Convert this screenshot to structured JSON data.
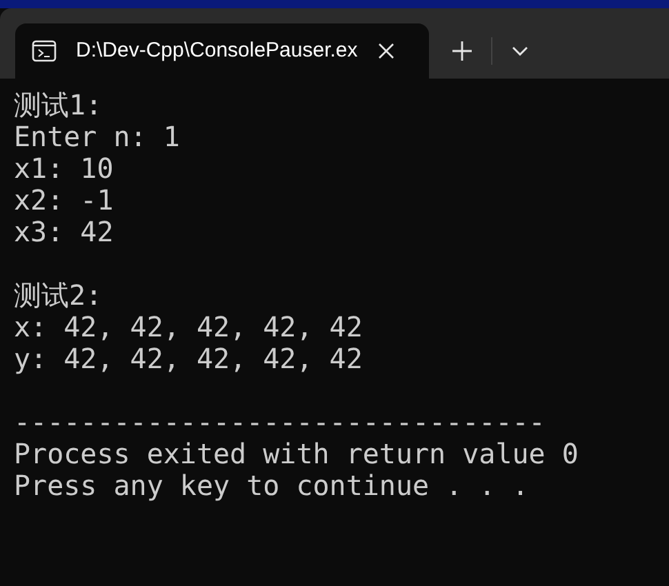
{
  "tab": {
    "title": "D:\\Dev-Cpp\\ConsolePauser.ex",
    "selected": true
  },
  "console": {
    "blocks": [
      [
        "测试1:",
        "Enter n: 1",
        "x1: 10",
        "x2: -1",
        "x3: 42"
      ],
      [
        "测试2:",
        "x: 42, 42, 42, 42, 42",
        "y: 42, 42, 42, 42, 42"
      ],
      [
        "--------------------------------",
        "Process exited with return value 0",
        "Press any key to continue . . ."
      ]
    ]
  }
}
